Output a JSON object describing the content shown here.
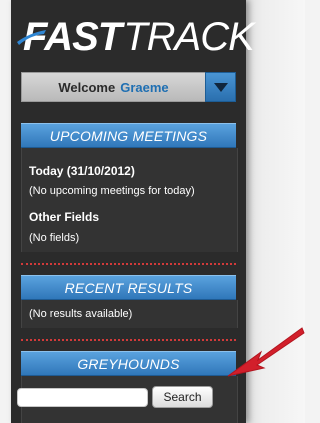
{
  "brand": {
    "fast": "FAST",
    "track": "TRACK",
    "accent_color": "#1f6fb2"
  },
  "welcome": {
    "greeting": "Welcome",
    "user": "Graeme",
    "toggle_icon": "chevron-down-icon"
  },
  "upcoming_meetings": {
    "title": "UPCOMING MEETINGS",
    "today_label": "Today (31/10/2012)",
    "today_note": "(No upcoming meetings for today)",
    "other_label": "Other Fields",
    "other_note": "(No fields)"
  },
  "recent_results": {
    "title": "RECENT RESULTS",
    "note": "(No results available)"
  },
  "greyhounds": {
    "title": "GREYHOUNDS",
    "search_value": "",
    "search_button": "Search"
  },
  "annotation": {
    "icon": "red-arrow-icon",
    "color": "#d21f2b"
  }
}
